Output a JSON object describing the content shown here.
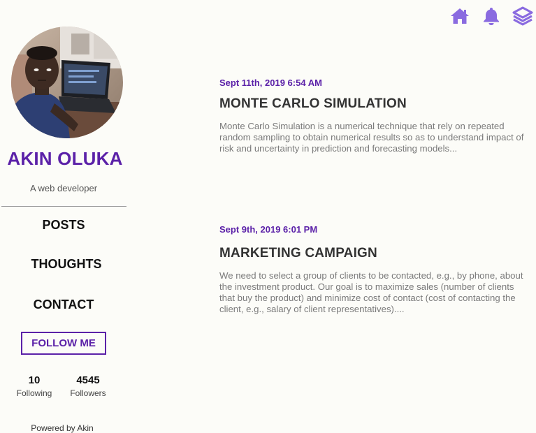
{
  "colors": {
    "accent": "#5b21a8",
    "icon": "#8a6be0",
    "background": "#fcfcf8"
  },
  "topbar": {
    "icons": [
      "home-icon",
      "bell-icon",
      "layers-icon"
    ]
  },
  "profile": {
    "name": "AKIN OLUKA",
    "tagline": "A web developer"
  },
  "nav": {
    "items": [
      {
        "label": "POSTS"
      },
      {
        "label": "THOUGHTS"
      },
      {
        "label": "CONTACT"
      }
    ]
  },
  "follow_button": "FOLLOW ME",
  "stats": {
    "following": {
      "value": "10",
      "label": "Following"
    },
    "followers": {
      "value": "4545",
      "label": "Followers"
    }
  },
  "footer": "Powered by Akin",
  "posts": [
    {
      "date": "Sept 11th, 2019 6:54 AM",
      "title": "MONTE CARLO SIMULATION",
      "excerpt": "Monte Carlo Simulation is a numerical technique that rely on repeated random sampling to obtain numerical results so as to understand impact of risk and uncertainty in prediction and forecasting models..."
    },
    {
      "date": "Sept 9th, 2019 6:01 PM",
      "title": "MARKETING CAMPAIGN",
      "excerpt": "We need to select a group of clients to be contacted, e.g., by phone, about the investment product. Our goal is to maximize sales (number of clients that buy the product) and minimize cost of contact (cost of contacting the client, e.g., salary of client representatives)...."
    }
  ]
}
